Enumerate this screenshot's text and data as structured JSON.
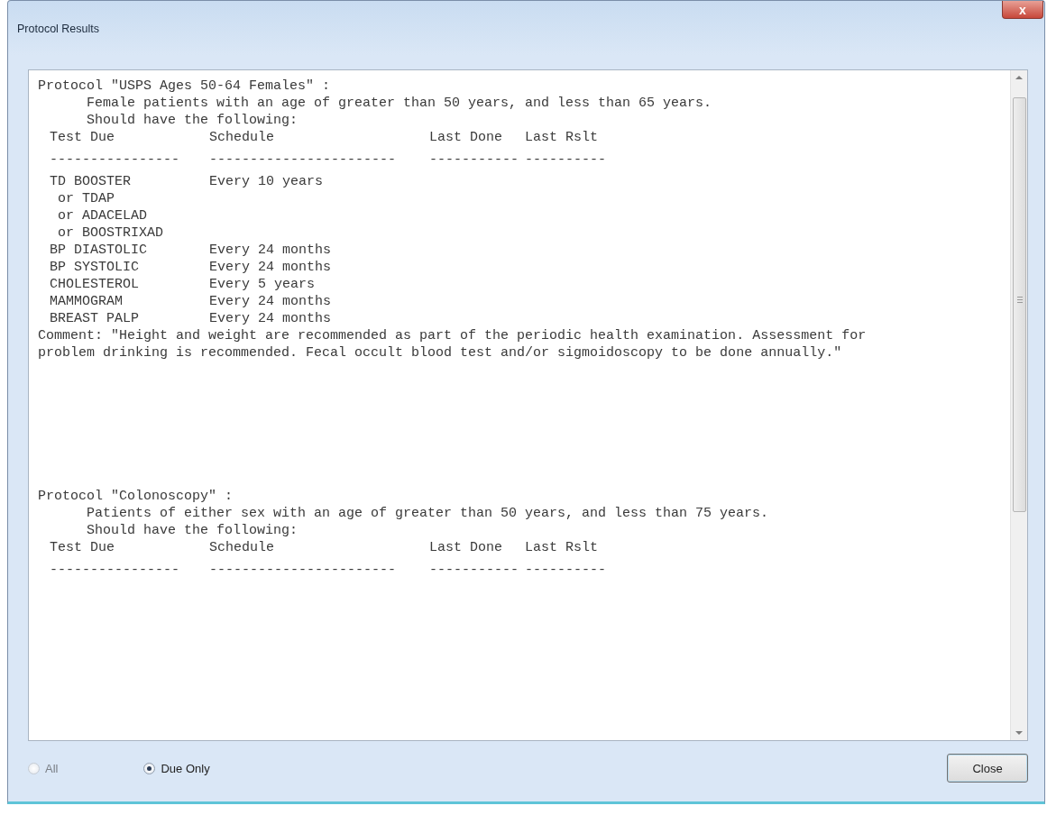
{
  "window": {
    "title": "Protocol Results",
    "close_glyph": "x"
  },
  "protocols": [
    {
      "title": "Protocol \"USPS Ages 50-64 Females\" :",
      "description": "Female patients with an age of greater than 50 years, and less than 65 years.",
      "instruction": "Should have the following:",
      "columns": [
        "Test Due",
        "Schedule",
        "Last Done",
        "Last Rslt"
      ],
      "separators": [
        "----------------",
        "-----------------------",
        "-----------",
        "----------"
      ],
      "rows": [
        {
          "test": "TD BOOSTER",
          "schedule": "Every 10 years",
          "alternatives": [
            "or TDAP",
            "or ADACELAD",
            "or BOOSTRIXAD"
          ]
        },
        {
          "test": "BP DIASTOLIC",
          "schedule": "Every 24 months"
        },
        {
          "test": "BP SYSTOLIC",
          "schedule": "Every 24 months"
        },
        {
          "test": "CHOLESTEROL",
          "schedule": "Every 5 years"
        },
        {
          "test": "MAMMOGRAM",
          "schedule": "Every 24 months"
        },
        {
          "test": "BREAST PALP",
          "schedule": "Every 24 months"
        }
      ],
      "comment_lines": [
        "Comment: \"Height and weight are recommended as part of the periodic health examination. Assessment for",
        "problem drinking is recommended. Fecal occult blood test and/or sigmoidoscopy to be done annually.\""
      ]
    },
    {
      "title": "Protocol \"Colonoscopy\" :",
      "description": "Patients of either sex with an age of greater than 50 years, and less than 75 years.",
      "instruction": "Should have the following:",
      "columns": [
        "Test Due",
        "Schedule",
        "Last Done",
        "Last Rslt"
      ],
      "separators": [
        "----------------",
        "-----------------------",
        "-----------",
        "----------"
      ]
    }
  ],
  "filter_options": [
    {
      "label": "All",
      "selected": false,
      "disabled": true
    },
    {
      "label": "Due Only",
      "selected": true,
      "disabled": false
    }
  ],
  "buttons": [
    {
      "label": "Close"
    }
  ]
}
